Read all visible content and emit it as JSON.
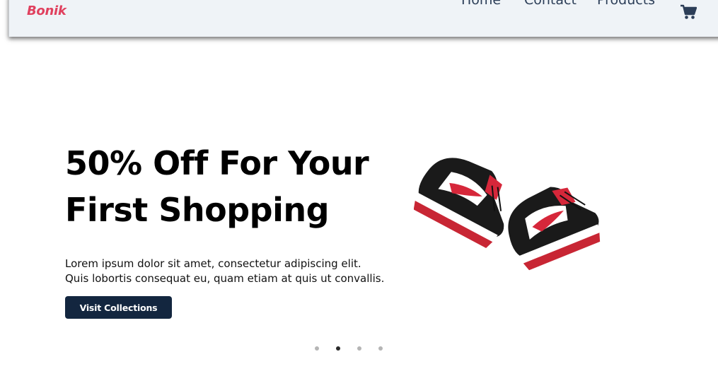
{
  "header": {
    "logo": "Bonik",
    "nav": [
      {
        "label": "Home"
      },
      {
        "label": "Contact"
      },
      {
        "label": "Products"
      }
    ],
    "cart_icon": "shopping-cart-icon"
  },
  "hero": {
    "title_line1": "50% Off For Your",
    "title_line2": "First Shopping",
    "desc_line1": "Lorem ipsum dolor sit amet, consectetur adipiscing elit.",
    "desc_line2": "Quis lobortis consequat eu, quam etiam at quis ut convallis.",
    "button_label": "Visit Collections",
    "image": "red-black-sneakers"
  },
  "carousel": {
    "slide_count": 4,
    "active_index": 1
  },
  "colors": {
    "logo": "#e0405e",
    "nav_text": "#2c3e58",
    "button_bg": "#13263f",
    "navbar_bg": "#eff3f7"
  }
}
